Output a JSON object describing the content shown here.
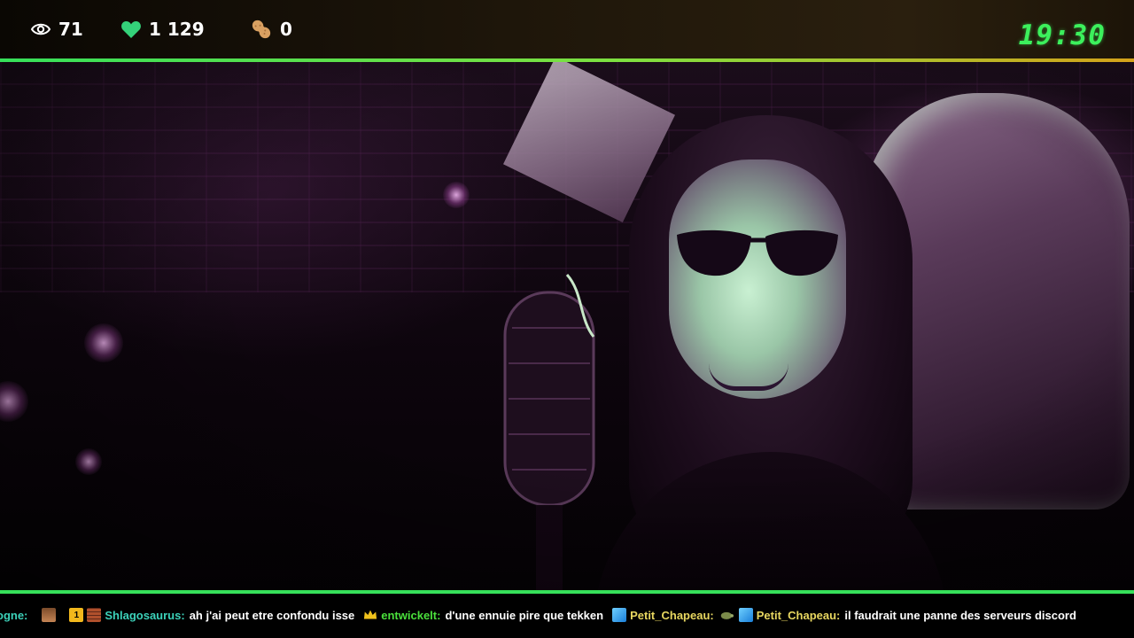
{
  "stats": {
    "viewers": "71",
    "likes": "1 129",
    "peanuts": "0"
  },
  "clock": "19:30",
  "colors": {
    "accent_green": "#36e05a",
    "clock_green": "#3cf05c",
    "heart_green": "#34d27a",
    "username_teal": "#3cd2ba",
    "username_gold": "#e8d760"
  },
  "icons": [
    "eye-icon",
    "heart-icon",
    "peanut-icon"
  ],
  "chat": {
    "lead_fragment": "ogne:",
    "messages": [
      {
        "user": "Shlagosaurus:",
        "text": "ah j'ai peut etre confondu isse"
      },
      {
        "user": "entwickelt:",
        "text": "d'une ennuie pire que tekken"
      },
      {
        "user": "Petit_Chapeau:",
        "text": ""
      },
      {
        "user": "Petit_Chapeau:",
        "text": "il faudrait une panne des serveurs discord"
      }
    ]
  }
}
